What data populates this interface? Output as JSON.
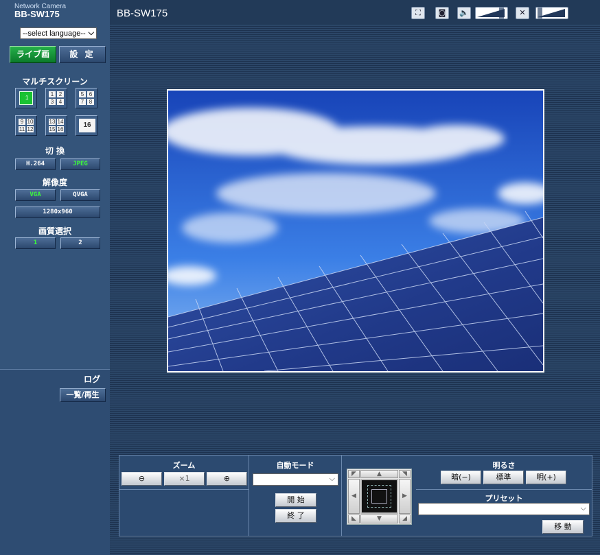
{
  "brand": {
    "top": "Network Camera",
    "model": "BB-SW175"
  },
  "language": {
    "selected": "--select language--"
  },
  "tabs": {
    "live": "ライブ画",
    "settings": "設 定"
  },
  "multiscreen": {
    "title": "マルチスクリーン",
    "icons": [
      {
        "name": "ms-single",
        "cells": [
          "1"
        ]
      },
      {
        "name": "ms-quad-1",
        "cells": [
          "1",
          "2",
          "3",
          "4"
        ]
      },
      {
        "name": "ms-quad-2",
        "cells": [
          "5",
          "6",
          "7",
          "8"
        ]
      },
      {
        "name": "ms-quad-3",
        "cells": [
          "9",
          "10",
          "11",
          "12"
        ]
      },
      {
        "name": "ms-quad-4",
        "cells": [
          "13",
          "14",
          "15",
          "16"
        ]
      },
      {
        "name": "ms-16",
        "cells": [
          "16"
        ]
      }
    ]
  },
  "switch": {
    "title": "切 換",
    "h264": "H.264",
    "jpeg": "JPEG"
  },
  "resolution": {
    "title": "解像度",
    "vga": "VGA",
    "qvga": "QVGA",
    "r1280": "1280x960"
  },
  "quality": {
    "title": "画質選択",
    "q1": "1",
    "q2": "2"
  },
  "log": {
    "title": "ログ",
    "button": "一覧/再生"
  },
  "topbar": {
    "title": "BB-SW175",
    "icons": [
      "fullscreen-icon",
      "camera-snapshot-icon",
      "speaker-icon",
      "mic-mute-icon"
    ]
  },
  "panel": {
    "zoom": {
      "title": "ズーム",
      "out": "⊖",
      "x1": "×1",
      "in": "⊕"
    },
    "auto_mode": {
      "title": "自動モード",
      "selected": "",
      "start": "開 始",
      "stop": "終 了"
    },
    "brightness": {
      "title": "明るさ",
      "dark": "暗(−)",
      "standard": "標準",
      "bright": "明(+)"
    },
    "preset": {
      "title": "プリセット",
      "selected": "",
      "move": "移 動"
    }
  },
  "colors": {
    "sidebar": "#34547a",
    "active_tab": "#1a9a3c",
    "active_text": "#3bfa3b"
  }
}
